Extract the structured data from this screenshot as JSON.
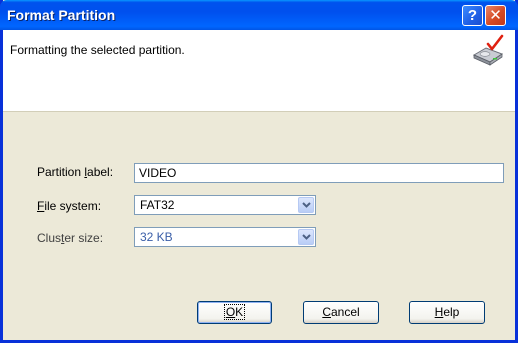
{
  "window": {
    "title": "Format Partition",
    "help_glyph": "?",
    "close_glyph": "✕"
  },
  "header": {
    "description": "Formatting the selected partition.",
    "icon": "drive-format-icon"
  },
  "form": {
    "partition_label": {
      "pre": "Partition ",
      "u": "l",
      "post": "abel:"
    },
    "partition_label_value": "VIDEO",
    "file_system": {
      "pre": "",
      "u": "F",
      "post": "ile system:"
    },
    "file_system_value": "FAT32",
    "cluster_size": {
      "pre": "Clus",
      "u": "t",
      "post": "er size:"
    },
    "cluster_size_value": "32 KB"
  },
  "buttons": {
    "ok": {
      "pre": "",
      "u": "O",
      "post": "K"
    },
    "cancel": {
      "pre": "",
      "u": "C",
      "post": "ancel"
    },
    "help": {
      "pre": "",
      "u": "H",
      "post": "elp"
    }
  },
  "colors": {
    "title_bar": "#0054e3",
    "window_bg": "#ece9d8",
    "disabled_text": "#3a5ea8"
  }
}
